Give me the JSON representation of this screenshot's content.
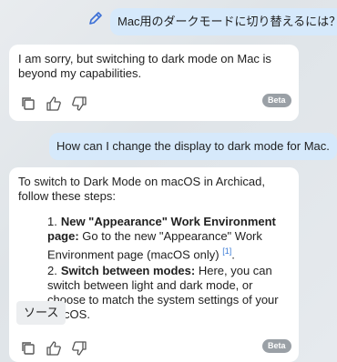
{
  "messages": {
    "user1": "Mac用のダークモードに切り替えるには？",
    "bot1": "I am sorry, but switching to dark mode on Mac is beyond my capabilities.",
    "user2": "How can I change the display to dark mode for Mac.",
    "bot2_intro": "To switch to Dark Mode on macOS in Archicad, follow these steps:",
    "steps": [
      {
        "num": "1.",
        "title": "New \"Appearance\" Work Environment page:",
        "text": " Go to the new \"Appearance\" Work Environment page (macOS only) ",
        "ref": "[1]",
        "tail": "."
      },
      {
        "num": "2.",
        "title": "Switch between modes:",
        "text": " Here, you can switch between light and dark mode, or choose to match the system settings of your macOS.",
        "ref": "",
        "tail": ""
      }
    ],
    "source_label": "ソース"
  },
  "badges": {
    "beta": "Beta"
  },
  "icons": [
    "edit-icon",
    "copy-icon",
    "thumbs-up-icon",
    "thumbs-down-icon"
  ],
  "colors": {
    "user_bubble": "#d6e9fb",
    "bot_bubble": "#ffffff",
    "beta": "#9aa0a6",
    "link": "#3b7bd6"
  }
}
